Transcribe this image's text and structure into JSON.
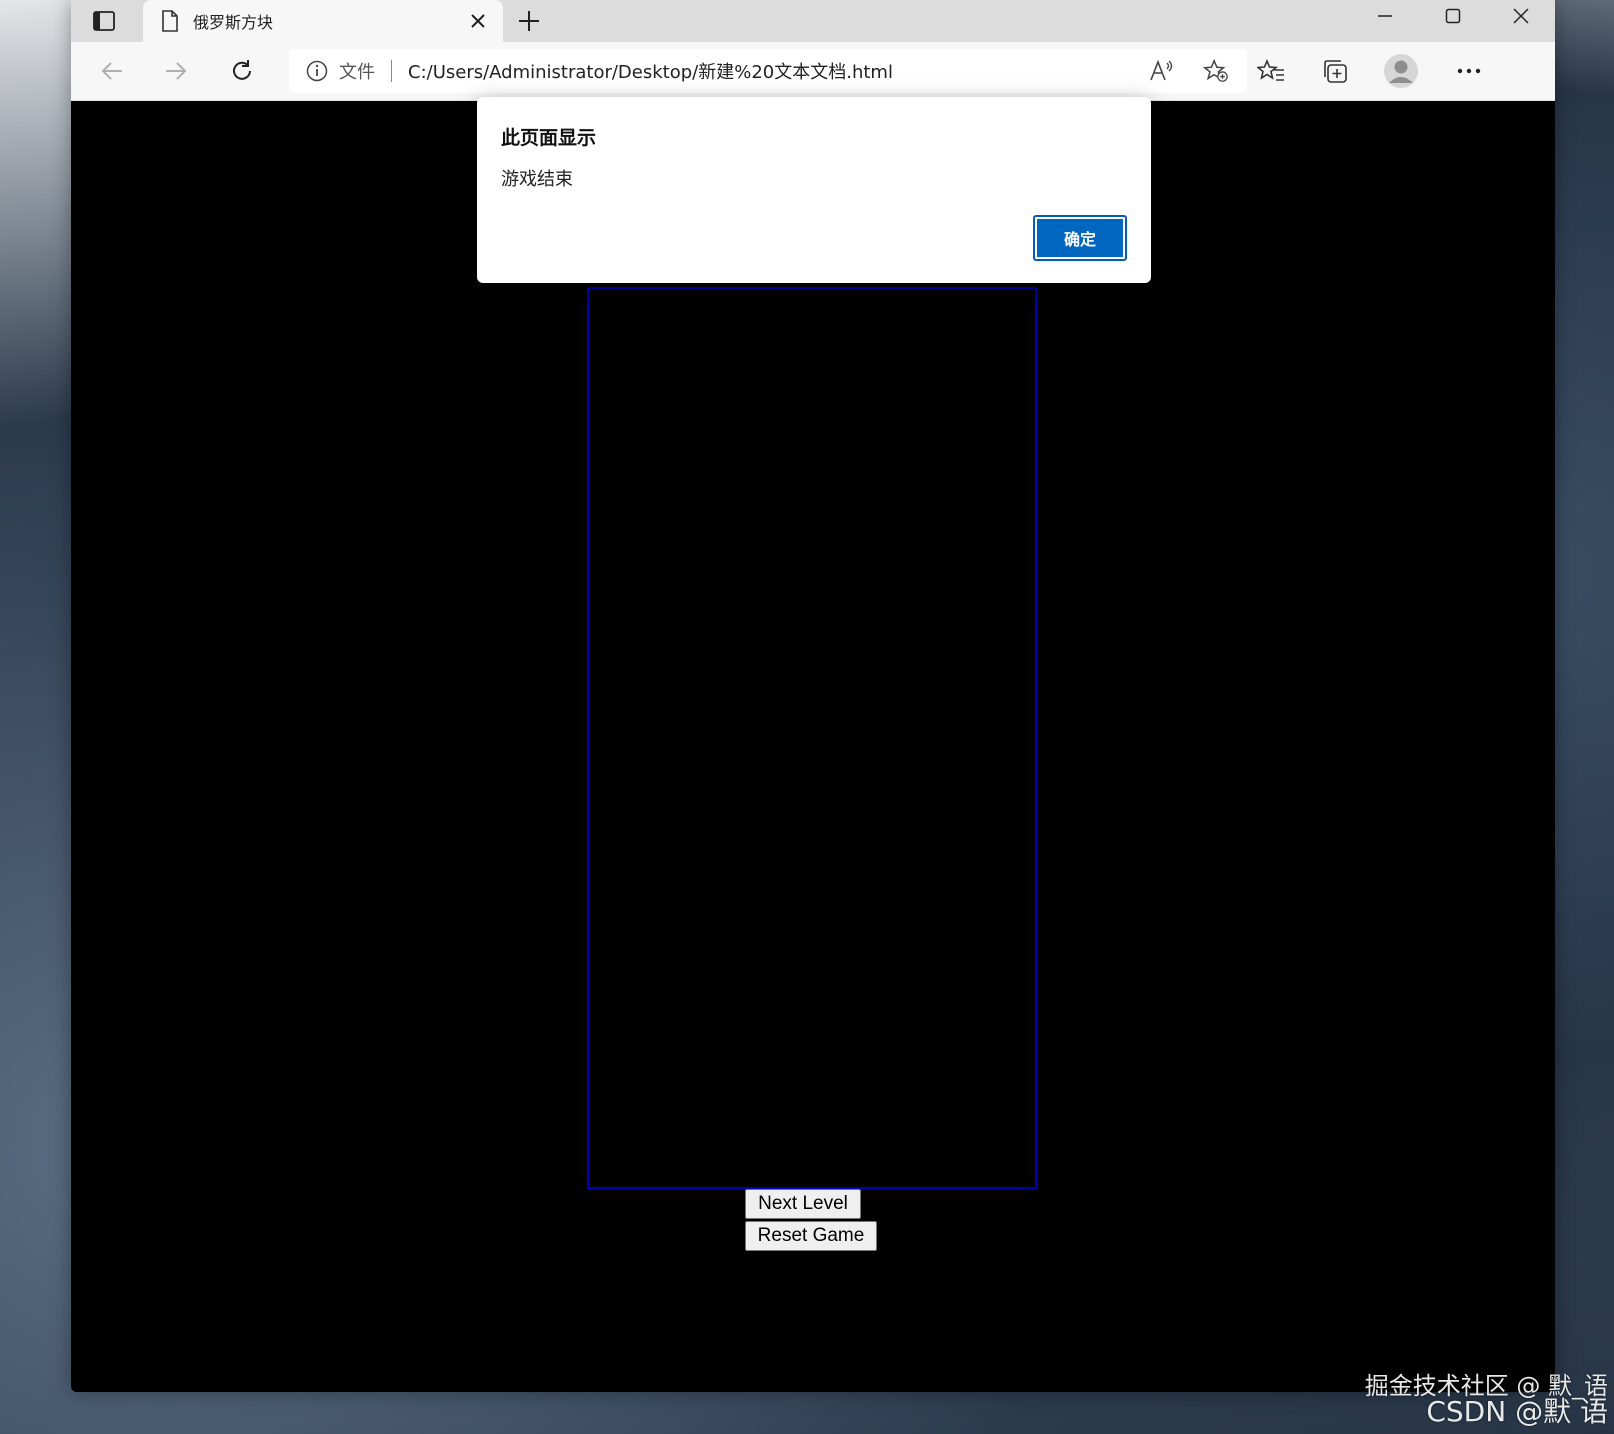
{
  "browser": {
    "tab_title": "俄罗斯方块",
    "address_scheme": "文件",
    "address_url": "C:/Users/Administrator/Desktop/新建%20文本文档.html"
  },
  "dialog": {
    "title": "此页面显示",
    "message": "游戏结束",
    "ok_label": "确定"
  },
  "game": {
    "next_level_label": "Next Level",
    "reset_game_label": "Reset Game",
    "board_border_color": "#0000b8"
  },
  "watermarks": {
    "juejin": "掘金技术社区 @ 默_语",
    "csdn": "CSDN @默   语"
  },
  "colors": {
    "dialog_button": "#0067c0",
    "page_background": "#000000"
  }
}
